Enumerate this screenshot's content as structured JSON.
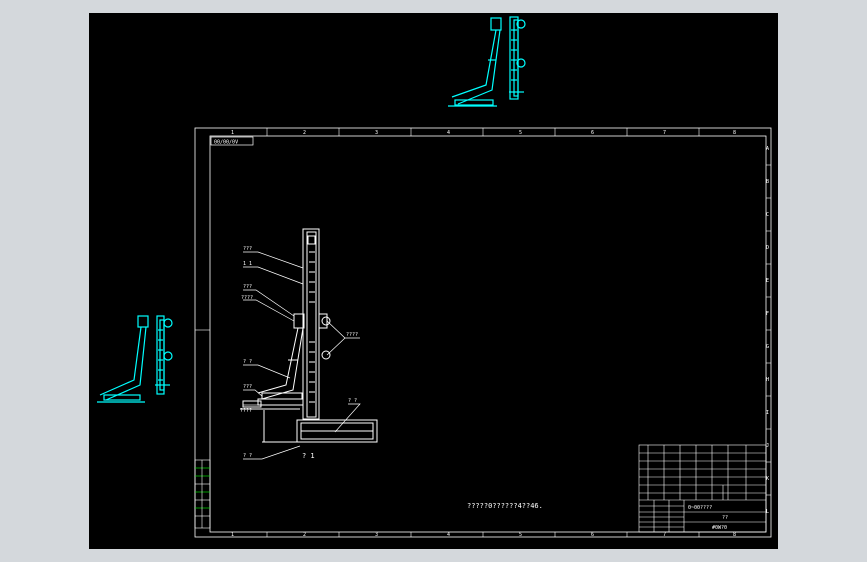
{
  "colors": {
    "background": "#d4d8dc",
    "viewport": "#000000",
    "line": "#ffffff",
    "accent": "#00ffff",
    "layer_green": "#00ff00"
  },
  "sheet": {
    "title_tag": "00/00/0V",
    "note": "?????0??????4??46.",
    "column_marks": [
      "1",
      "2",
      "3",
      "4",
      "5",
      "6",
      "7",
      "8"
    ],
    "row_marks": [
      "A",
      "B",
      "C",
      "D",
      "E",
      "F",
      "G",
      "H",
      "I",
      "J",
      "K",
      "L"
    ]
  },
  "part_labels": {
    "l1": "???",
    "l2": "1 1",
    "l3": "???",
    "l4": "????",
    "l5": "? ?",
    "l6": "???",
    "l7": "????",
    "l8": "? ?",
    "l9": "? ?",
    "l10": "? 1",
    "l11": "????"
  },
  "title_block": {
    "drawing_code": "0~00????",
    "designation": "??",
    "company": "#0W?0"
  }
}
